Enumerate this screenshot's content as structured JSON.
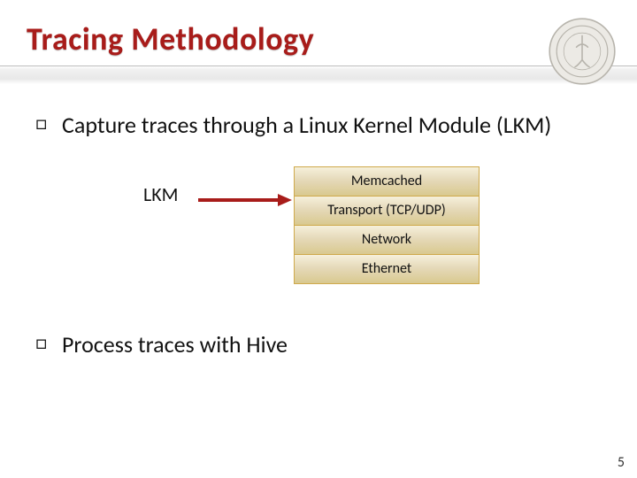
{
  "title": "Tracing Methodology",
  "bullets": {
    "b1": "Capture traces through a Linux Kernel Module (LKM)",
    "b2": "Process traces with Hive"
  },
  "diagram": {
    "lkm_label": "LKM",
    "layers": {
      "l0": "Memcached",
      "l1": "Transport (TCP/UDP)",
      "l2": "Network",
      "l3": "Ethernet"
    }
  },
  "page_number": "5",
  "colors": {
    "accent": "#a81c1a",
    "layer_fill": "#e5d9b9",
    "layer_border": "#cfa94b"
  }
}
